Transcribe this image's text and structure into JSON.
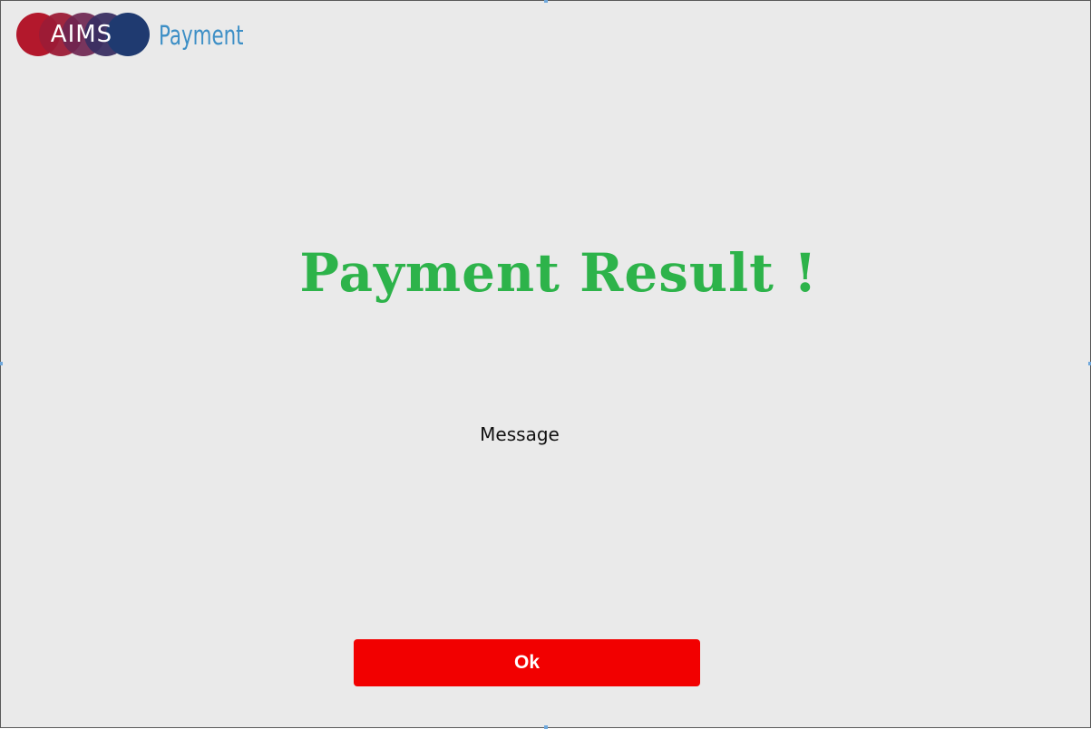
{
  "brand": {
    "logo_text": "AIMS",
    "subtitle": "Payment",
    "logo_colors": [
      "#b3182c",
      "#8e1f3e",
      "#5f2752",
      "#2e3466",
      "#1f3a70"
    ],
    "subtitle_color": "#3d8fc6"
  },
  "result": {
    "title": "Payment Result !",
    "title_color": "#2db34a",
    "message": "Message"
  },
  "actions": {
    "ok_label": "Ok",
    "ok_color": "#f20000"
  }
}
